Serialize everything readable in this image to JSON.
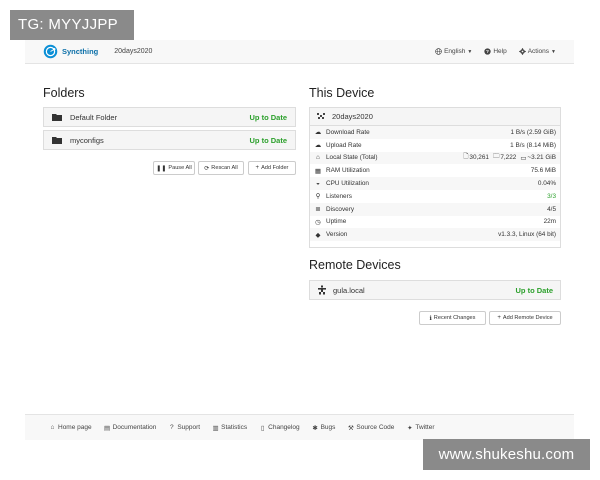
{
  "watermarks": {
    "top_left": "TG: MYYJJPP",
    "bottom_right": "www.shukeshu.com"
  },
  "navbar": {
    "brand": "Syncthing",
    "device_name": "20days2020",
    "language": "English",
    "help": "Help",
    "actions": "Actions"
  },
  "folders": {
    "heading": "Folders",
    "items": [
      {
        "name": "Default Folder",
        "status": "Up to Date"
      },
      {
        "name": "myconfigs",
        "status": "Up to Date"
      }
    ],
    "buttons": {
      "pause_all": "Pause All",
      "rescan_all": "Rescan All",
      "add_folder": "Add Folder"
    }
  },
  "this_device": {
    "heading": "This Device",
    "name": "20days2020",
    "stats": [
      {
        "icon": "cloud-download-icon",
        "label": "Download Rate",
        "value": "1 B/s (2.59 GiB)"
      },
      {
        "icon": "cloud-upload-icon",
        "label": "Upload Rate",
        "value": "1 B/s (8.14 MiB)"
      },
      {
        "icon": "home-icon",
        "label": "Local State (Total)",
        "value": "30,261",
        "value2": "7,222",
        "value3": "~3.21 GiB"
      },
      {
        "icon": "ram-icon",
        "label": "RAM Utilization",
        "value": "75.6 MiB"
      },
      {
        "icon": "cpu-icon",
        "label": "CPU Utilization",
        "value": "0.04%"
      },
      {
        "icon": "sitemap-icon",
        "label": "Listeners",
        "value": "3/3",
        "green": true
      },
      {
        "icon": "discovery-icon",
        "label": "Discovery",
        "value": "4/5"
      },
      {
        "icon": "clock-icon",
        "label": "Uptime",
        "value": "22m"
      },
      {
        "icon": "tag-icon",
        "label": "Version",
        "value": "v1.3.3, Linux (64 bit)"
      }
    ]
  },
  "remote_devices": {
    "heading": "Remote Devices",
    "items": [
      {
        "name": "gula.local",
        "status": "Up to Date"
      }
    ],
    "buttons": {
      "recent_changes": "Recent Changes",
      "add_remote_device": "Add Remote Device"
    }
  },
  "footer": {
    "links": [
      {
        "icon": "home-icon",
        "label": "Home page"
      },
      {
        "icon": "book-icon",
        "label": "Documentation"
      },
      {
        "icon": "question-icon",
        "label": "Support"
      },
      {
        "icon": "bar-chart-icon",
        "label": "Statistics"
      },
      {
        "icon": "file-icon",
        "label": "Changelog"
      },
      {
        "icon": "bug-icon",
        "label": "Bugs"
      },
      {
        "icon": "wrench-icon",
        "label": "Source Code"
      },
      {
        "icon": "twitter-icon",
        "label": "Twitter"
      }
    ]
  },
  "colors": {
    "accent": "#0b6fa8",
    "status_green": "#2ca02c"
  }
}
